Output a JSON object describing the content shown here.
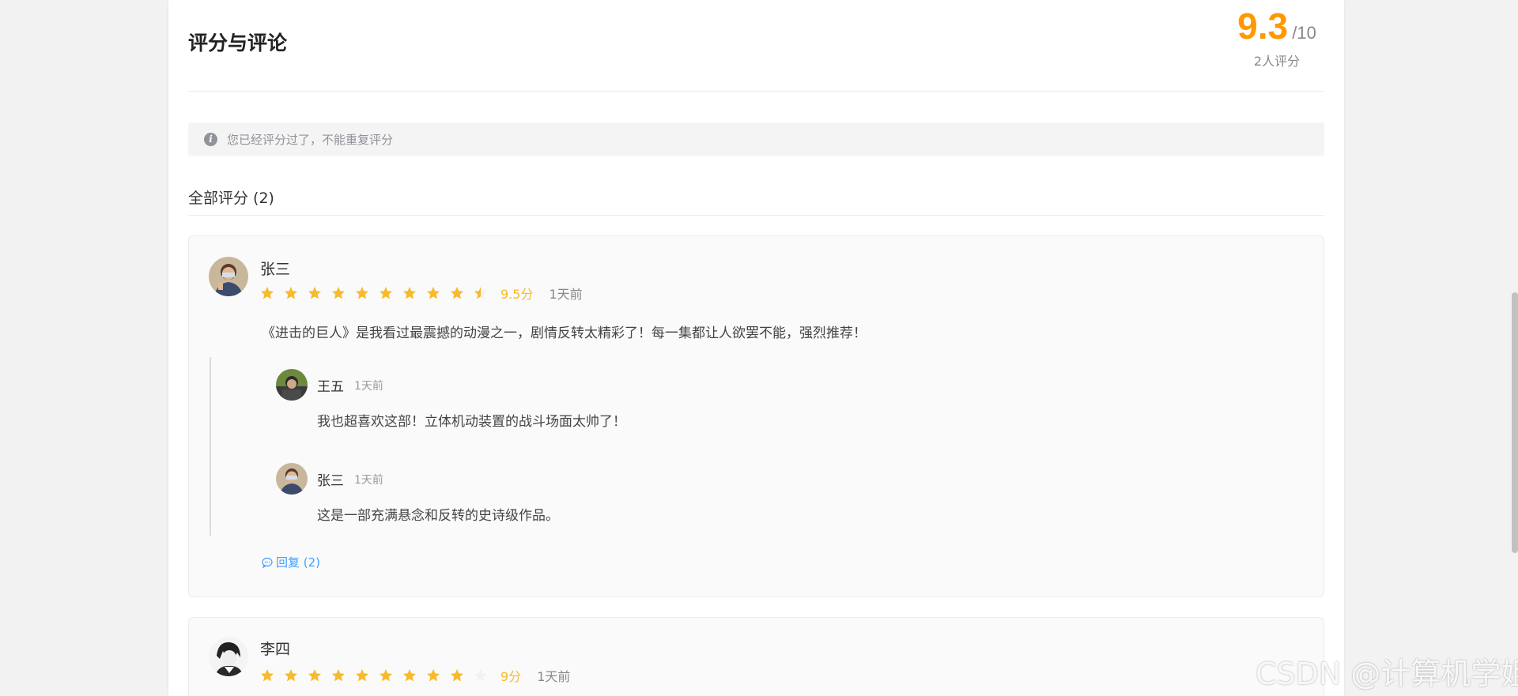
{
  "header": {
    "title": "评分与评论",
    "score": "9.3",
    "score_total": "/10",
    "rating_count": "2人评分"
  },
  "notice": {
    "icon": "info-icon",
    "text": "您已经评分过了，不能重复评分"
  },
  "reviews_heading": "全部评分 (2)",
  "colors": {
    "accent": "#ff9900",
    "star": "#f7ba2a",
    "link": "#409eff",
    "star_empty": "#eff2f7"
  },
  "reviews": [
    {
      "user": "张三",
      "stars": 9.5,
      "rating_text": "9.5分",
      "time": "1天前",
      "comment": "《进击的巨人》是我看过最震撼的动漫之一，剧情反转太精彩了！每一集都让人欲罢不能，强烈推荐！",
      "replies": [
        {
          "user": "王五",
          "time": "1天前",
          "text": "我也超喜欢这部！立体机动装置的战斗场面太帅了！"
        },
        {
          "user": "张三",
          "time": "1天前",
          "text": "这是一部充满悬念和反转的史诗级作品。"
        }
      ],
      "reply_link": "回复 (2)"
    },
    {
      "user": "李四",
      "stars": 9,
      "rating_text": "9分",
      "time": "1天前"
    }
  ],
  "watermark": "CSDN @计算机学姐"
}
